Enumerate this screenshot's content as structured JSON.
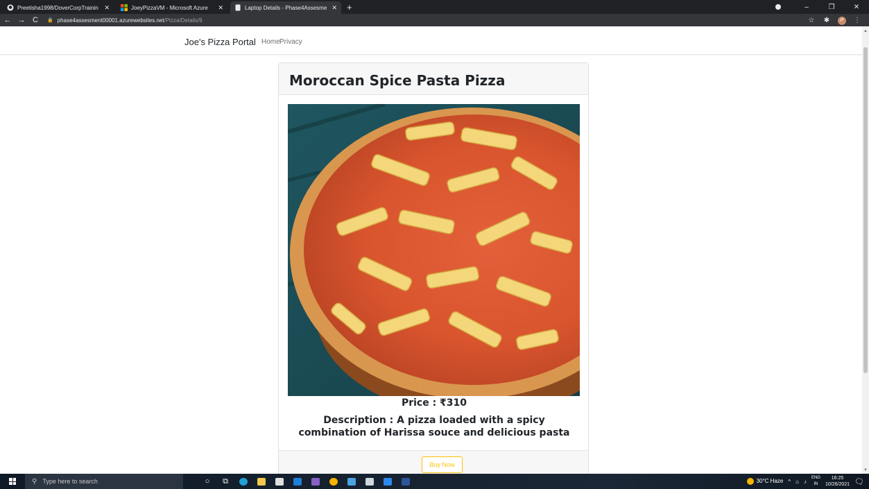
{
  "browser": {
    "tabs": [
      {
        "title": "Preetisha1998/DoverCorpTrainin",
        "icon": "github-icon",
        "active": false
      },
      {
        "title": "JoeyPizzaVM - Microsoft Azure",
        "icon": "microsoft-icon",
        "active": false
      },
      {
        "title": "Laptop Details - Phase4Assesme",
        "icon": "page-icon",
        "active": true
      }
    ],
    "new_tab": "+",
    "url_host": "phase4assesment00001.azurewebsites.net",
    "url_path": "/Pizza/Details/9"
  },
  "site": {
    "brand": "Joe's Pizza Portal",
    "nav": {
      "home": "Home",
      "privacy": "Privacy"
    }
  },
  "pizza": {
    "title": "Moroccan Spice Pasta Pizza",
    "price": "Price : ₹310",
    "description": "Description : A pizza loaded with a spicy combination of Harissa souce and delicious pasta",
    "buy_label": "Buy Now"
  },
  "taskbar": {
    "search_placeholder": "Type here to search",
    "weather": "30°C  Haze",
    "lang_top": "ENG",
    "lang_bottom": "IN",
    "time": "16:25",
    "date": "10/26/2021"
  },
  "colors": {
    "button_accent": "#ffc107",
    "chrome_dark": "#202124",
    "chrome_toolbar": "#35363a"
  }
}
